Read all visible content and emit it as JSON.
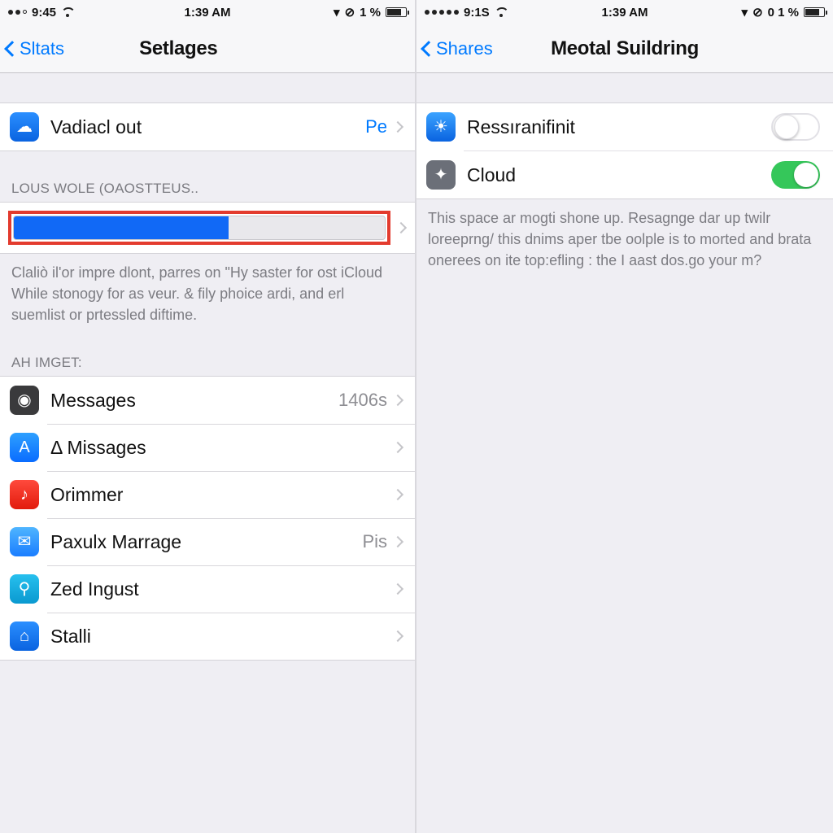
{
  "left": {
    "status": {
      "signal_text": "••○",
      "time_left": "9:45",
      "time_center": "1:39 AM",
      "battery_text": "1 %",
      "loc_icon": "▾",
      "alarm_icon": "⊘"
    },
    "nav": {
      "back_label": "Sltats",
      "title": "Setlages"
    },
    "vadiacl": {
      "icon": "weather",
      "label": "Vadiacl out",
      "detail": "Pe"
    },
    "storage": {
      "header": "LOUS WOLE (OAOSTTEUS..",
      "used_percent": 58,
      "footer": "Claliò il'or impre dlont, parres on \"Hy saster for ost iCloud While stonogy for as veur. & fily phoice ardi, and erl suemlist or prtessled diftime."
    },
    "list_header": "AH IMGET:",
    "apps": [
      {
        "name": "messages",
        "label": "Messages",
        "detail": "1406s",
        "icon": "photos"
      },
      {
        "name": "missages",
        "label": "Δ Missages",
        "detail": "",
        "icon": "appstore"
      },
      {
        "name": "orimmer",
        "label": "Orimmer",
        "detail": "",
        "icon": "music"
      },
      {
        "name": "paxulx",
        "label": "Paxulx Marrage",
        "detail": "Pis",
        "icon": "mail"
      },
      {
        "name": "zed",
        "label": "Zed Ingust",
        "detail": "",
        "icon": "contacts"
      },
      {
        "name": "stalli",
        "label": "Stalli",
        "detail": "",
        "icon": "home"
      }
    ]
  },
  "right": {
    "status": {
      "signal_text": "•••••",
      "time_left": "9:1S",
      "time_center": "1:39 AM",
      "battery_text": "0 1 %",
      "loc_icon": "▾",
      "alarm_icon": "⊘"
    },
    "nav": {
      "back_label": "Shares",
      "title": "Meotal Suildring"
    },
    "items": [
      {
        "name": "ressiranifinit",
        "label": "Ressıranifinit",
        "icon": "weather2",
        "toggle": "off"
      },
      {
        "name": "cloud",
        "label": "Cloud",
        "icon": "cloud2",
        "toggle": "on"
      }
    ],
    "footer": "This space ar mogti shone up. Resagnge dar up twilr loreeprng/ this dnims aper tbe oolple is to morted and brata onerees on ite top:efling : the I aast dos.go your m?"
  }
}
